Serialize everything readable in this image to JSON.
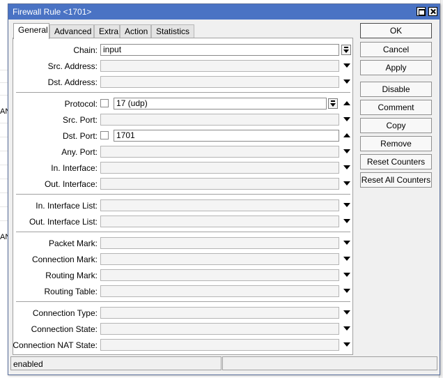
{
  "window": {
    "title": "Firewall Rule <1701>"
  },
  "background": {
    "edge_text_1": "AN",
    "edge_text_2": "AN"
  },
  "tabs": [
    {
      "label": "General",
      "active": true
    },
    {
      "label": "Advanced"
    },
    {
      "label": "Extra"
    },
    {
      "label": "Action"
    },
    {
      "label": "Statistics"
    }
  ],
  "fields": {
    "chain": {
      "label": "Chain:",
      "value": "input"
    },
    "src_address": {
      "label": "Src. Address:",
      "value": ""
    },
    "dst_address": {
      "label": "Dst. Address:",
      "value": ""
    },
    "protocol": {
      "label": "Protocol:",
      "value": "17 (udp)"
    },
    "src_port": {
      "label": "Src. Port:",
      "value": ""
    },
    "dst_port": {
      "label": "Dst. Port:",
      "value": "1701"
    },
    "any_port": {
      "label": "Any. Port:",
      "value": ""
    },
    "in_interface": {
      "label": "In. Interface:",
      "value": ""
    },
    "out_interface": {
      "label": "Out. Interface:",
      "value": ""
    },
    "in_interface_list": {
      "label": "In. Interface List:",
      "value": ""
    },
    "out_interface_list": {
      "label": "Out. Interface List:",
      "value": ""
    },
    "packet_mark": {
      "label": "Packet Mark:",
      "value": ""
    },
    "connection_mark": {
      "label": "Connection Mark:",
      "value": ""
    },
    "routing_mark": {
      "label": "Routing Mark:",
      "value": ""
    },
    "routing_table": {
      "label": "Routing Table:",
      "value": ""
    },
    "connection_type": {
      "label": "Connection Type:",
      "value": ""
    },
    "connection_state": {
      "label": "Connection State:",
      "value": ""
    },
    "connection_nat_state": {
      "label": "Connection NAT State:",
      "value": ""
    }
  },
  "buttons": {
    "ok": "OK",
    "cancel": "Cancel",
    "apply": "Apply",
    "disable": "Disable",
    "comment": "Comment",
    "copy": "Copy",
    "remove": "Remove",
    "reset_counters": "Reset Counters",
    "reset_all_counters": "Reset All Counters"
  },
  "status": {
    "left": "enabled",
    "right": ""
  }
}
